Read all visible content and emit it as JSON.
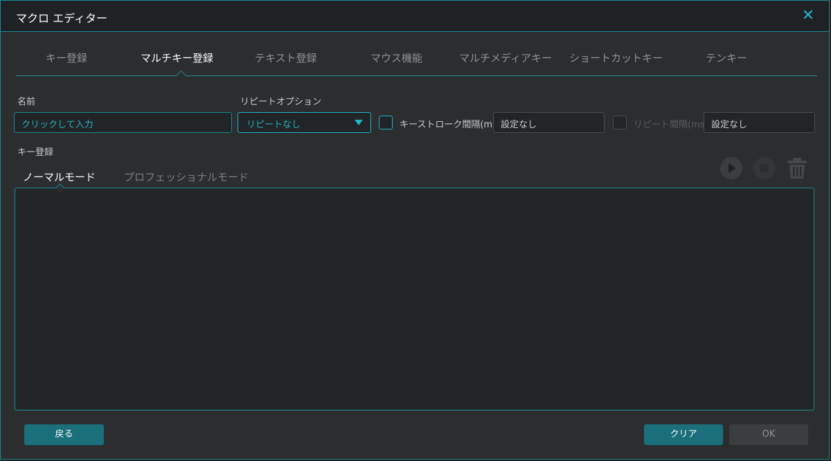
{
  "window": {
    "title": "マクロ エディター"
  },
  "tabs": [
    {
      "label": "キー登録"
    },
    {
      "label": "マルチキー登録",
      "active": true
    },
    {
      "label": "テキスト登録"
    },
    {
      "label": "マウス機能"
    },
    {
      "label": "マルチメディアキー"
    },
    {
      "label": "ショートカットキー"
    },
    {
      "label": "テンキー"
    }
  ],
  "form": {
    "name_label": "名前",
    "name_placeholder": "クリックして入力",
    "repeat_label": "リピートオプション",
    "repeat_value": "リピートなし",
    "keystroke_interval_label": "キーストローク間隔(ms)",
    "keystroke_interval_value": "設定なし",
    "repeat_interval_label": "リピート間隔(ms)",
    "repeat_interval_value": "設定なし"
  },
  "key_section": {
    "label": "キー登録",
    "modes": [
      {
        "label": "ノーマルモード",
        "active": true
      },
      {
        "label": "プロフェッショナルモード"
      }
    ]
  },
  "footer": {
    "back_label": "戻る",
    "clear_label": "クリア",
    "ok_label": "OK"
  },
  "colors": {
    "accent": "#24b3c4",
    "border": "#1a8a95",
    "background": "#2b2d2f",
    "primary_button": "#1a6f7a"
  }
}
